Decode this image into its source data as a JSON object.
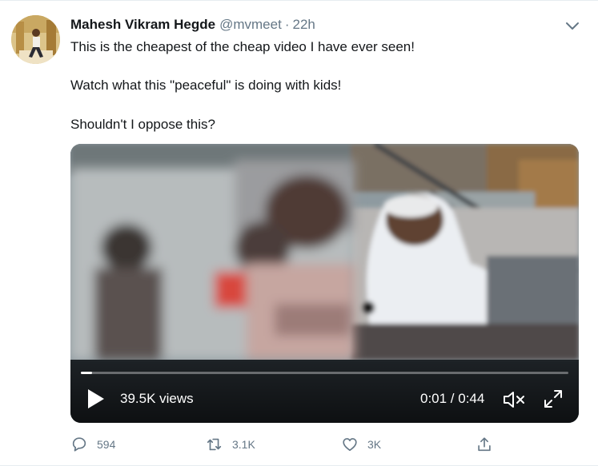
{
  "tweet": {
    "display_name": "Mahesh Vikram Hegde",
    "handle": "@mvmeet",
    "separator": "·",
    "time": "22h",
    "lines": [
      "This is the cheapest of the cheap video I have ever seen!",
      "Watch what this \"peaceful\" is doing with kids!",
      "Shouldn't I oppose this?"
    ]
  },
  "video": {
    "views": "39.5K views",
    "timecode": "0:01 / 0:44",
    "progress": 0.023
  },
  "actions": {
    "reply_count": "594",
    "retweet_count": "3.1K",
    "like_count": "3K"
  },
  "icons": {
    "menu": "chevron-down-icon",
    "play": "play-icon",
    "mute": "speaker-muted-icon",
    "fullscreen": "expand-icon",
    "reply": "comment-icon",
    "retweet": "retweet-icon",
    "like": "heart-icon",
    "share": "share-icon"
  },
  "colors": {
    "text": "#14171a",
    "secondary": "#657786",
    "border": "#e6ecf0"
  }
}
